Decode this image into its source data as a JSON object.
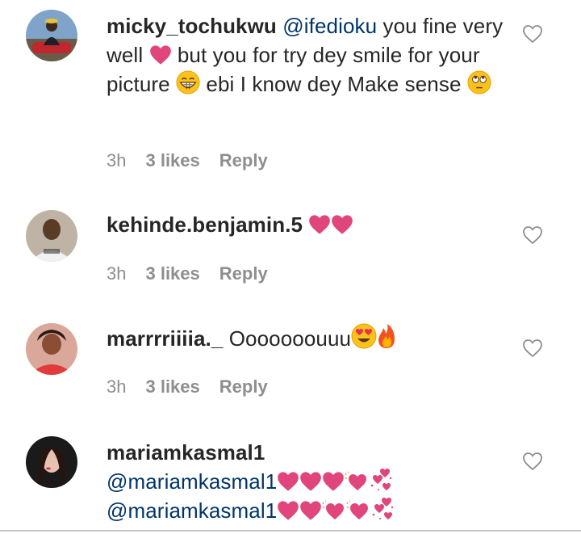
{
  "comments": [
    {
      "username": "micky_tochukwu",
      "mention": "@ifedioku",
      "text_1": "you fine very well",
      "text_2": "but you for try dey smile for your picture",
      "text_3": "ebi I know dey Make sense",
      "time": "3h",
      "likes": "3 likes",
      "reply": "Reply"
    },
    {
      "username": "kehinde.benjamin.5",
      "time": "3h",
      "likes": "3 likes",
      "reply": "Reply"
    },
    {
      "username": "marrrriiiia._",
      "text": "Ooooooouuu",
      "time": "3h",
      "likes": "3 likes",
      "reply": "Reply"
    },
    {
      "username": "mariamkasmal1",
      "mention_1": "@mariamkasmal1",
      "mention_2": "@mariamkasmal1"
    }
  ],
  "icons": {
    "heart_emoji_color": "#e0457b",
    "like_icon": "heart-outline-icon",
    "mention_color": "#003569",
    "meta_color": "#8e8e8e"
  }
}
